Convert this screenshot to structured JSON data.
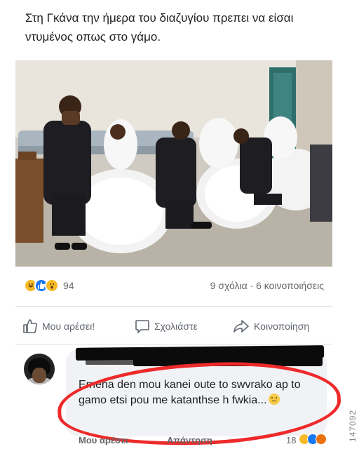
{
  "post": {
    "caption": "Στη Γκάνα την ήμερα του διαζυγίου πρεπει να είσαι ντυμένος οπως στο γάμο."
  },
  "reactions": {
    "count": "94",
    "icons": [
      "haha-icon",
      "like-icon",
      "wow-icon"
    ],
    "stats": "9 σχόλια · 6 κοινοποιήσεις"
  },
  "actions": {
    "like": "Μου αρέσει!",
    "comment": "Σχολιάστε",
    "share": "Κοινοποίηση"
  },
  "comment": {
    "text": "Emena den mou kanei oute to swvrako ap to gamo etsi pou me katanthse h fwkia...",
    "emoji": "thinking-face-icon",
    "footer_like": "Μου αρέσει",
    "footer_reply": "Απάντηση",
    "footer_count": "18"
  },
  "watermark": "147092",
  "colors": {
    "highlight": "#ee2a2a",
    "like_blue": "#1877f2",
    "reaction_yellow": "#f7b928"
  }
}
